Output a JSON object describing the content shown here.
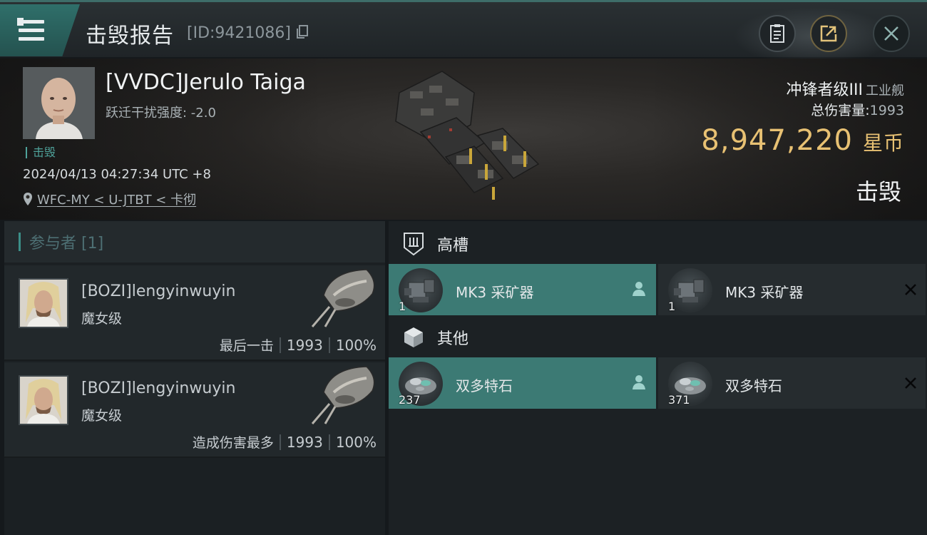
{
  "header": {
    "title": "击毁报告",
    "report_id": "[ID:9421086]"
  },
  "victim": {
    "name": "[VVDC]Jerulo Taiga",
    "warp_scramble": "跃迁干扰强度: -2.0",
    "status": "击毁",
    "time": "2024/04/13 04:27:34 UTC +8",
    "location": "WFC-MY < U-JTBT < 卡彻"
  },
  "ship": {
    "class_name": "冲锋者级III",
    "class_type": "工业舰",
    "damage_label": "总伤害量:",
    "damage_value": "1993",
    "isk_value": "8,947,220",
    "isk_unit": "星币",
    "result": "击毁"
  },
  "participants": {
    "header": "参与者 [1]",
    "list": [
      {
        "name": "[BOZI]lengyinwuyin",
        "ship": "魔女级",
        "tag": "最后一击",
        "damage": "1993",
        "percent": "100%"
      },
      {
        "name": "[BOZI]lengyinwuyin",
        "ship": "魔女级",
        "tag": "造成伤害最多",
        "damage": "1993",
        "percent": "100%"
      }
    ]
  },
  "fittings": {
    "high": {
      "label": "高槽",
      "items": [
        {
          "name": "MK3 采矿器",
          "qty": "1",
          "state": "dropped"
        },
        {
          "name": "MK3 采矿器",
          "qty": "1",
          "state": "destroyed"
        }
      ]
    },
    "other": {
      "label": "其他",
      "items": [
        {
          "name": "双多特石",
          "qty": "237",
          "state": "dropped"
        },
        {
          "name": "双多特石",
          "qty": "371",
          "state": "destroyed"
        }
      ]
    }
  },
  "colors": {
    "accent": "#3c8f88",
    "dropped": "#3c7a74",
    "isk": "#e8c173"
  },
  "icons": {
    "menu": "menu-icon",
    "clipboard": "clipboard-icon",
    "share": "share-icon",
    "close": "close-icon",
    "location": "location-pin-icon",
    "high_slot": "high-slot-icon",
    "other": "cargo-box-icon",
    "person": "person-icon",
    "destroyed": "cross-icon"
  }
}
